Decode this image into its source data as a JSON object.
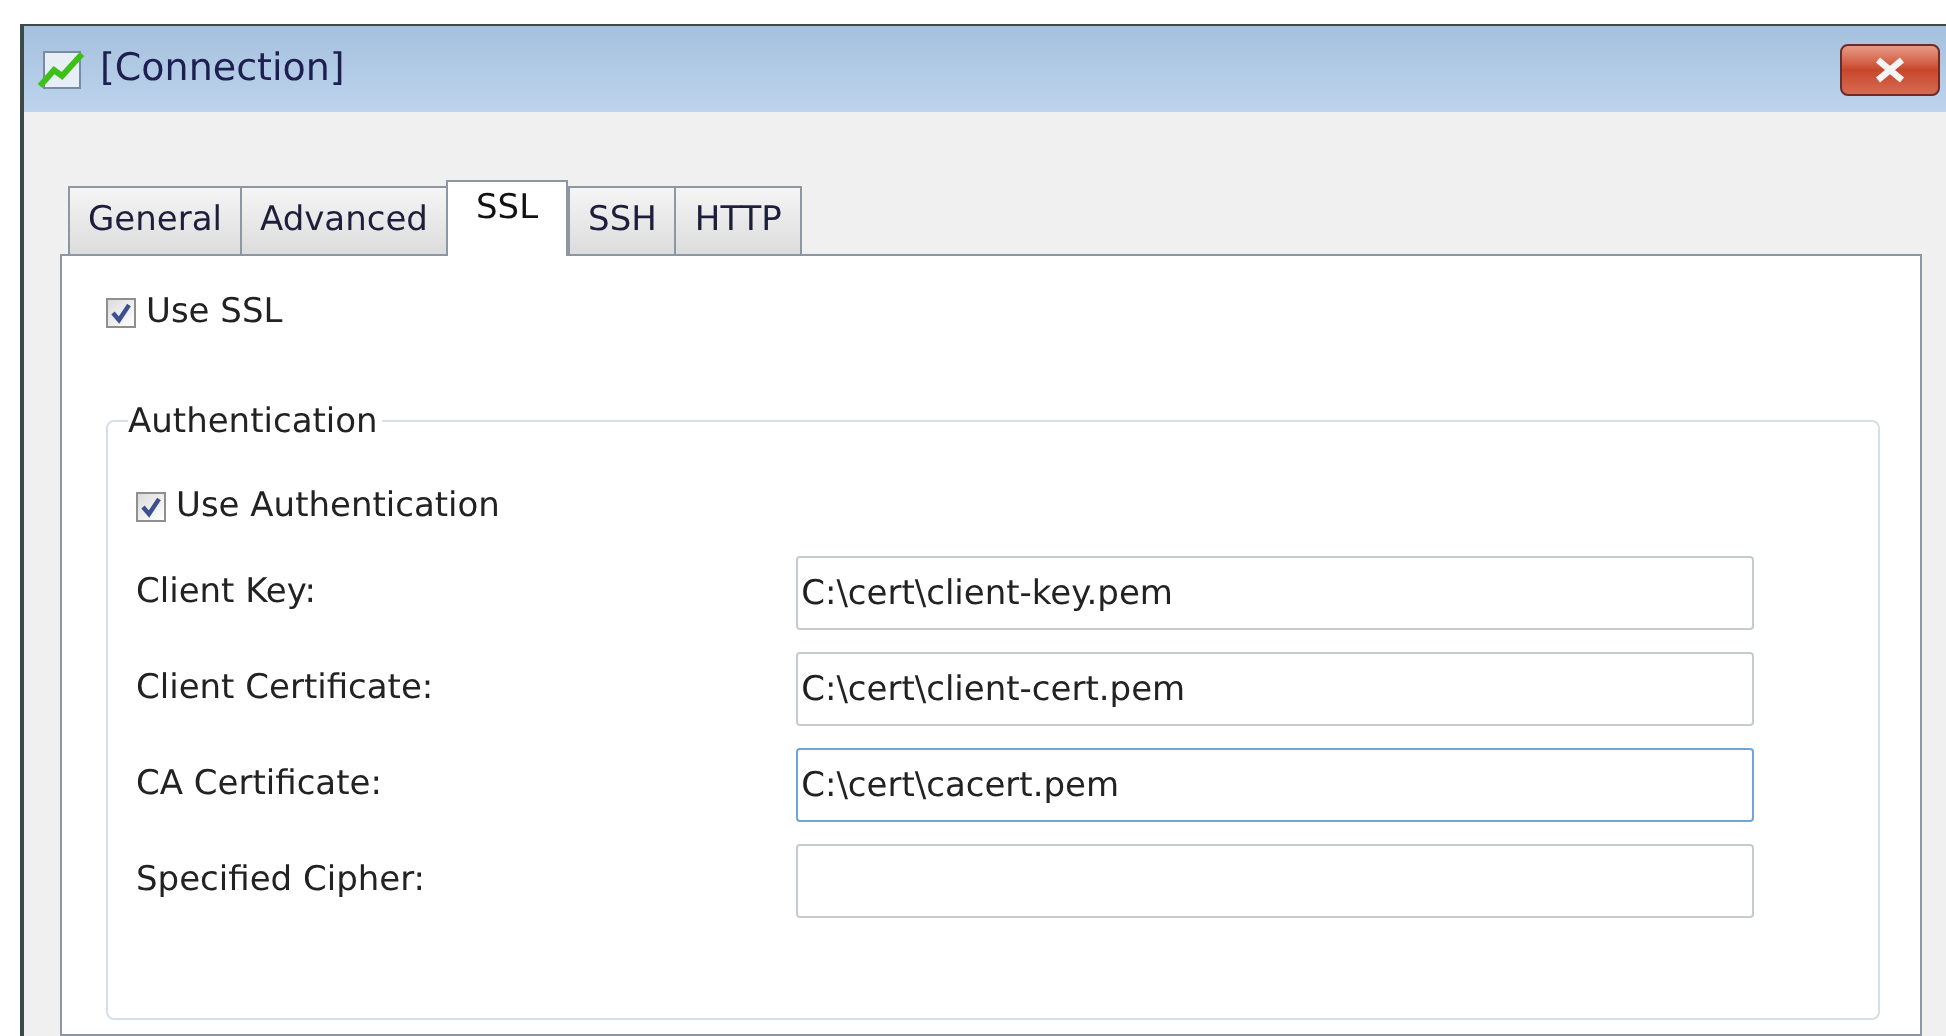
{
  "window": {
    "title": "[Connection]"
  },
  "tabs": [
    {
      "label": "General",
      "selected": false
    },
    {
      "label": "Advanced",
      "selected": false
    },
    {
      "label": "SSL",
      "selected": true
    },
    {
      "label": "SSH",
      "selected": false
    },
    {
      "label": "HTTP",
      "selected": false
    }
  ],
  "use_ssl": {
    "label": "Use SSL",
    "checked": true
  },
  "authentication": {
    "title": "Authentication",
    "use_authentication": {
      "label": "Use Authentication",
      "checked": true
    },
    "fields": [
      {
        "label": "Client Key:",
        "value": "C:\\cert\\client-key.pem",
        "focused": false
      },
      {
        "label": "Client Certificate:",
        "value": "C:\\cert\\client-cert.pem",
        "focused": false
      },
      {
        "label": "CA Certificate:",
        "value": "C:\\cert\\cacert.pem",
        "focused": true
      },
      {
        "label": "Specified Cipher:",
        "focused": false
      }
    ]
  }
}
